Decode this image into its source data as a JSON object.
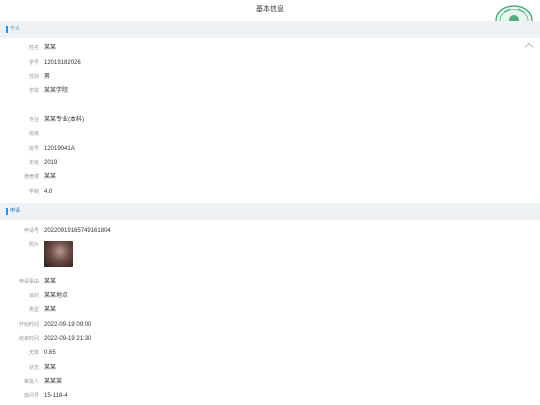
{
  "page": {
    "title": "基本信息"
  },
  "sections": [
    {
      "title": "个人",
      "rows": [
        {
          "label": "姓名",
          "value": "某某"
        },
        {
          "label": "学号",
          "value": "12019182026"
        },
        {
          "label": "性别",
          "value": "男"
        },
        {
          "label": "学院",
          "value": "某某学院"
        },
        {
          "label": "",
          "value": ""
        },
        {
          "label": "专业",
          "value": "某某专业(本科)"
        },
        {
          "label": "班级",
          "value": ""
        },
        {
          "label": "班号",
          "value": "12019041A"
        },
        {
          "label": "年级",
          "value": "2019"
        },
        {
          "label": "宿舍楼",
          "value": "某某"
        },
        {
          "label": "学制",
          "value": "4.0"
        }
      ]
    },
    {
      "title": "申请",
      "rows": [
        {
          "label": "申请号",
          "value": "20220919165749161804"
        },
        {
          "label": "照片",
          "value": ""
        },
        {
          "label": "申请事由",
          "value": "某某"
        },
        {
          "label": "目的",
          "value": "某某地点"
        },
        {
          "label": "类型",
          "value": "某某"
        },
        {
          "label": "开始时间",
          "value": "2022-09-19 09:00"
        },
        {
          "label": "结束时间",
          "value": "2022-09-19 21:30"
        },
        {
          "label": "天数",
          "value": "0.65"
        },
        {
          "label": "状态",
          "value": "某某"
        },
        {
          "label": "审批人",
          "value": "某某某"
        },
        {
          "label": "房间号",
          "value": "15-118-4"
        }
      ]
    }
  ],
  "icons": {
    "collapse": "chevron-up-icon",
    "stamp": "seal-stamp-icon"
  },
  "colors": {
    "header_bg": "#eef2f5",
    "accent": "#2d8cf0",
    "stamp": "#3aa06a"
  }
}
